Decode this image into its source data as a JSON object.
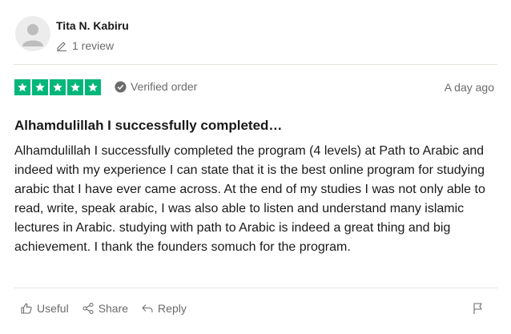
{
  "reviewer": {
    "name": "Tita N. Kabiru",
    "review_count": "1 review"
  },
  "rating": {
    "stars": 5,
    "max": 5,
    "color": "#00b67a"
  },
  "verified_label": "Verified order",
  "date": "A day ago",
  "review": {
    "title": "Alhamdulillah I successfully completed…",
    "body": "Alhamdulillah I successfully completed the program (4 levels) at Path to Arabic and indeed with my experience I can state that it is the best online program for studying arabic that I have ever came across. At the end of my studies I was not only able to read, write, speak arabic, I was also able to listen and understand many islamic lectures in Arabic. studying with path to Arabic is indeed a great thing and big achievement. I thank the founders somuch for the program."
  },
  "actions": {
    "useful": "Useful",
    "share": "Share",
    "reply": "Reply"
  },
  "icons": [
    "user-avatar-icon",
    "pencil-icon",
    "star-icon",
    "check-circle-icon",
    "thumbs-up-icon",
    "share-icon",
    "reply-icon",
    "flag-icon"
  ]
}
